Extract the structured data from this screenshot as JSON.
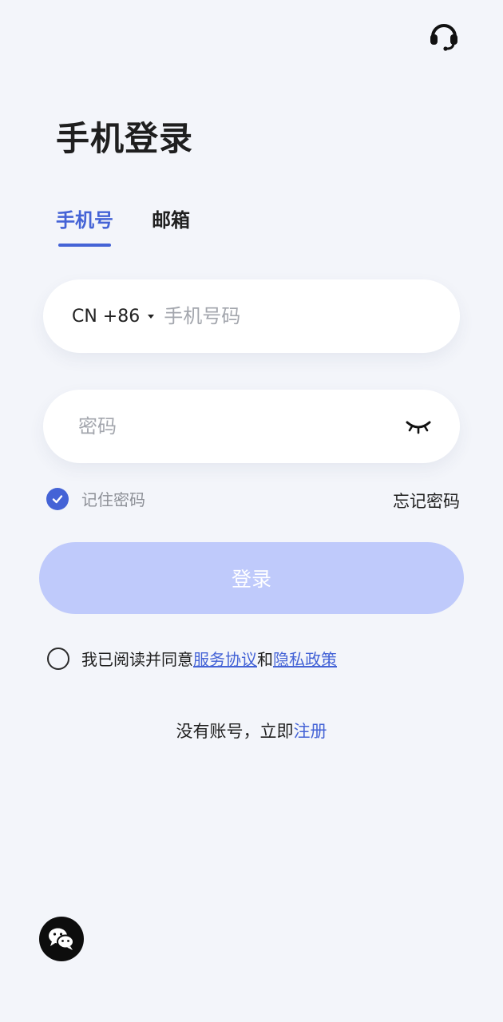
{
  "header": {
    "support_icon": "headset-icon"
  },
  "page_title": "手机登录",
  "tabs": [
    {
      "label": "手机号",
      "active": true
    },
    {
      "label": "邮箱",
      "active": false
    }
  ],
  "phone_form": {
    "country_code": "CN +86",
    "phone_placeholder": "手机号码",
    "password_placeholder": "密码"
  },
  "remember": {
    "label": "记住密码",
    "checked": true
  },
  "forgot_label": "忘记密码",
  "login_label": "登录",
  "agreement": {
    "prefix": "我已阅读并同意",
    "service_link": "服务协议",
    "conjunction": "和",
    "privacy_link": "隐私政策",
    "checked": false
  },
  "register": {
    "prefix": "没有账号，立即",
    "link": "注册"
  },
  "social": {
    "wechat_icon": "wechat-icon"
  },
  "colors": {
    "accent": "#4463d6",
    "button_disabled": "#bfcafb",
    "background": "#f3f5fa"
  }
}
